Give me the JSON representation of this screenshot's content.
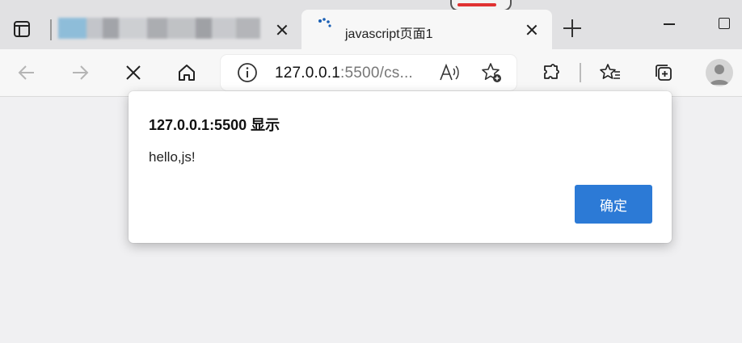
{
  "tabs": [
    {
      "label": "",
      "blurred": true
    },
    {
      "label": "javascript页面1",
      "loading": true,
      "active": true
    }
  ],
  "address_bar": {
    "host": "127.0.0.1",
    "rest": ":5500/cs..."
  },
  "dialog": {
    "title": "127.0.0.1:5500 显示",
    "message": "hello,js!",
    "ok_label": "确定"
  },
  "colors": {
    "accent": "#2c7ad6",
    "tab_active": "#f7f7f7",
    "tabbar": "#e1e1e3",
    "page": "#f0f0f2"
  }
}
